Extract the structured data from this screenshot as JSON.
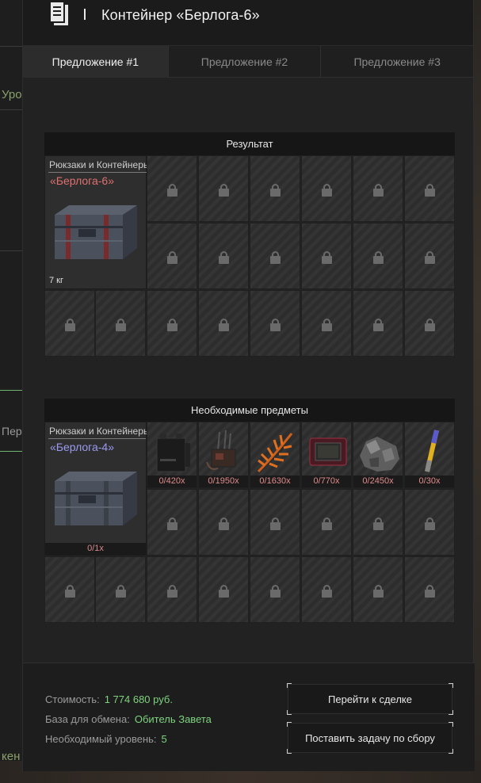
{
  "background": {
    "left_texts": [
      "Уро",
      "Пере",
      "кен"
    ]
  },
  "header": {
    "title": "Контейнер «Берлога-6»"
  },
  "tabs": [
    {
      "label": "Предложение #1",
      "active": true
    },
    {
      "label": "Предложение #2",
      "active": false
    },
    {
      "label": "Предложение #3",
      "active": false
    }
  ],
  "result": {
    "title": "Результат",
    "item": {
      "category": "Рюкзаки и Контейнеры",
      "name": "«Берлога-6»",
      "name_color": "#e07070",
      "weight": "7 кг"
    }
  },
  "required": {
    "title": "Необходимые предметы",
    "main_item": {
      "category": "Рюкзаки и Контейнеры",
      "name": "«Берлога-4»",
      "name_color": "#9a9af0",
      "count": "0/1x"
    },
    "items": [
      {
        "icon": "battery-icon",
        "count": "0/420x"
      },
      {
        "icon": "detonator-icon",
        "count": "0/1950x"
      },
      {
        "icon": "fern-icon",
        "count": "0/1630x"
      },
      {
        "icon": "tablet-icon",
        "count": "0/770x"
      },
      {
        "icon": "ore-icon",
        "count": "0/2450x"
      },
      {
        "icon": "rod-icon",
        "count": "0/30x"
      }
    ]
  },
  "footer": {
    "cost_label": "Стоимость:",
    "cost_value": "1 774 680 руб.",
    "base_label": "База для обмена:",
    "base_value": "Обитель Завета",
    "level_label": "Необходимый уровень:",
    "level_value": "5",
    "goto_button": "Перейти к сделке",
    "task_button": "Поставить задачу по сбору"
  },
  "colors": {
    "accent_green": "#7fd37f",
    "count_red": "#e28a8a"
  }
}
